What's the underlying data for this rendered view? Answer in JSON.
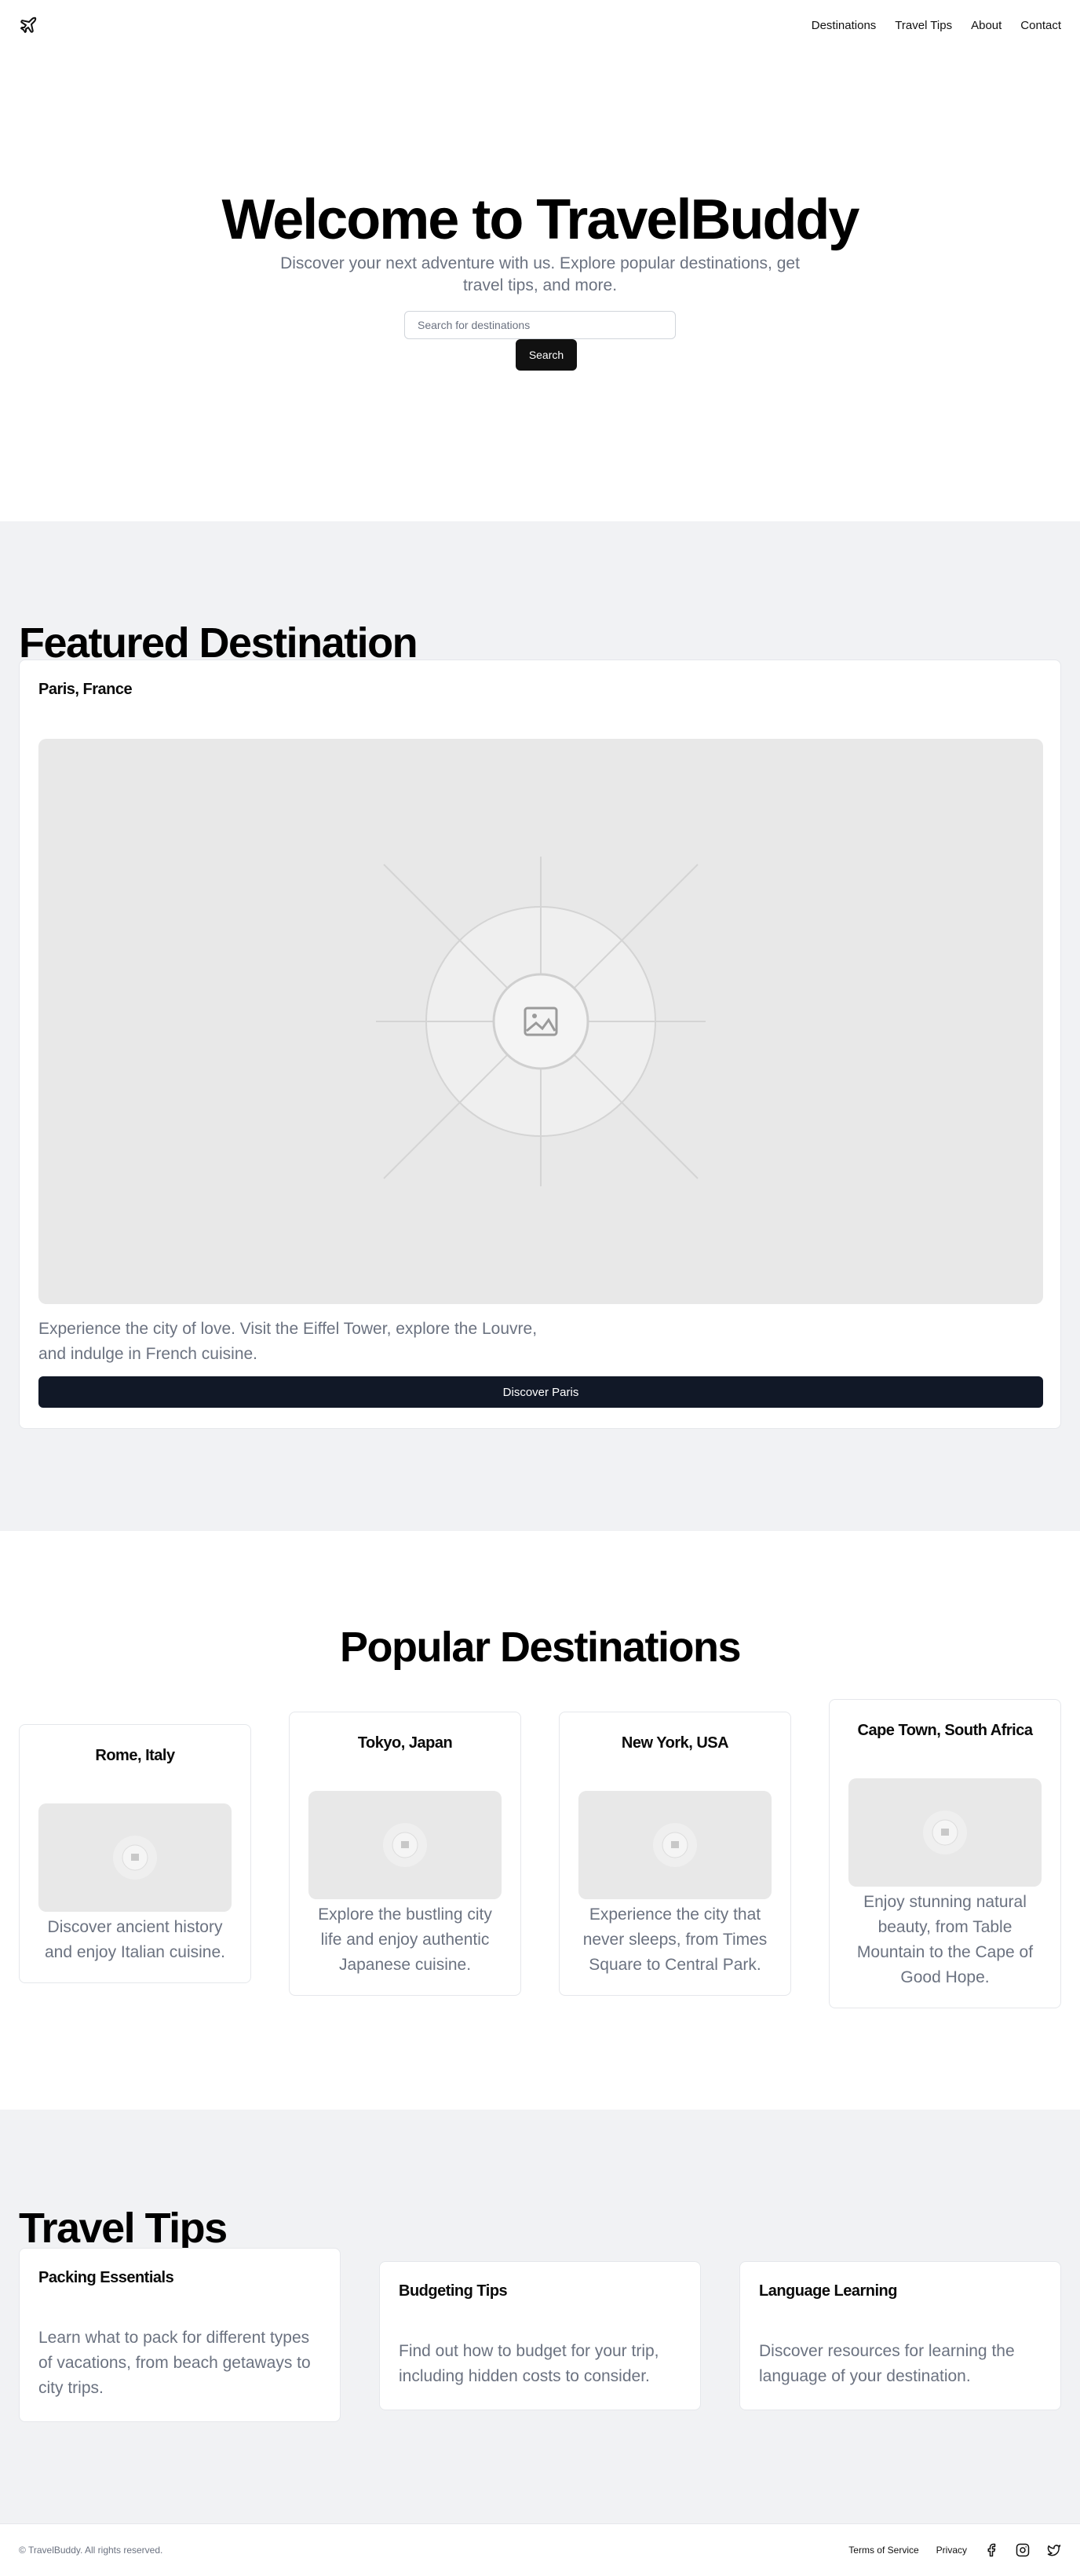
{
  "nav": {
    "items": [
      "Destinations",
      "Travel Tips",
      "About",
      "Contact"
    ]
  },
  "hero": {
    "title": "Welcome to TravelBuddy",
    "subtitle": "Discover your next adventure with us. Explore popular destinations, get travel tips, and more.",
    "search_placeholder": "Search for destinations",
    "search_button": "Search"
  },
  "featured": {
    "heading": "Featured Destination",
    "card_title": "Paris, France",
    "description": "Experience the city of love. Visit the Eiffel Tower, explore the Louvre, and indulge in French cuisine.",
    "button": "Discover Paris"
  },
  "popular": {
    "heading": "Popular Destinations",
    "cards": [
      {
        "title": "Rome, Italy",
        "description": "Discover ancient history and enjoy Italian cuisine."
      },
      {
        "title": "Tokyo, Japan",
        "description": "Explore the bustling city life and enjoy authentic Japanese cuisine."
      },
      {
        "title": "New York, USA",
        "description": "Experience the city that never sleeps, from Times Square to Central Park."
      },
      {
        "title": "Cape Town, South Africa",
        "description": "Enjoy stunning natural beauty, from Table Mountain to the Cape of Good Hope."
      }
    ]
  },
  "tips": {
    "heading": "Travel Tips",
    "cards": [
      {
        "title": "Packing Essentials",
        "description": "Learn what to pack for different types of vacations, from beach getaways to city trips."
      },
      {
        "title": "Budgeting Tips",
        "description": "Find out how to budget for your trip, including hidden costs to consider."
      },
      {
        "title": "Language Learning",
        "description": "Discover resources for learning the language of your destination."
      }
    ]
  },
  "footer": {
    "copyright": "© TravelBuddy. All rights reserved.",
    "links": [
      "Terms of Service",
      "Privacy"
    ],
    "social_icons": [
      "facebook-icon",
      "instagram-icon",
      "twitter-icon"
    ]
  },
  "colors": {
    "primary_button": "#111827",
    "section_bg": "#f1f2f4",
    "muted_text": "#6b7280"
  }
}
